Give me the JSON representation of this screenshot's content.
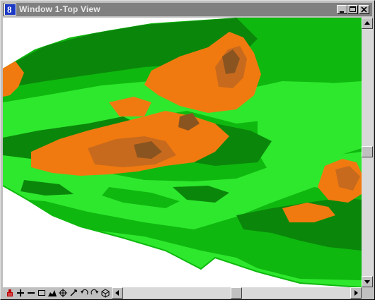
{
  "window": {
    "title": "Window 1-Top View",
    "controls": [
      "minimize",
      "maximize",
      "close"
    ]
  },
  "view": {
    "content": "3D shaded terrain model (top view)",
    "palette": {
      "light_green": "#2ee82e",
      "mid_green": "#0fb80f",
      "dark_green": "#0a870a",
      "orange": "#f07a10",
      "light_brown": "#c86a1d",
      "dark_brown": "#8a5420",
      "background": "#ffffff"
    }
  },
  "view_controls": {
    "icons": [
      "update-view-icon",
      "zoom-in-icon",
      "zoom-out-icon",
      "window-area-icon",
      "fit-view-icon",
      "rotate-view-icon",
      "pan-icon",
      "view-previous-icon",
      "view-next-icon",
      "copy-view-icon"
    ]
  },
  "scrollbars": {
    "vertical_position": 0.5,
    "horizontal_position": 0.5
  }
}
